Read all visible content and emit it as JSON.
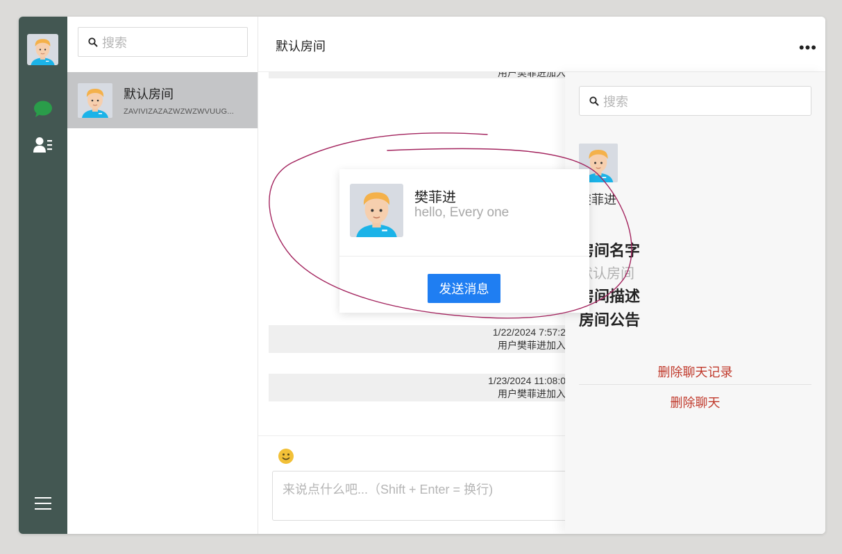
{
  "colors": {
    "rail": "#435752",
    "accent": "#1f7ef2",
    "danger": "#c0392b",
    "chat_icon": "#2a9d4a",
    "emoji": "#f2c037",
    "annotation": "#a3245e"
  },
  "list": {
    "search_placeholder": "搜索",
    "rooms": [
      {
        "name": "默认房间",
        "subtitle": "ZAVIVIZAZAZWZWZWVUUG..."
      }
    ]
  },
  "chat": {
    "title": "默认房间",
    "more_label": "•••",
    "messages": [
      {
        "time": "",
        "text": "用户樊菲进加入"
      },
      {
        "time": "1/22/2024 7:57:2",
        "text": "用户樊菲进加入"
      },
      {
        "time": "1/23/2024 11:08:0",
        "text": "用户樊菲进加入"
      }
    ],
    "input_placeholder": "来说点什么吧...（Shift + Enter = 换行)"
  },
  "drawer": {
    "search_placeholder": "搜索",
    "member_name": "樊菲进",
    "room_name_label": "房间名字",
    "room_name_value": "默认房间",
    "room_desc_label": "房间描述",
    "room_notice_label": "房间公告",
    "clear_history": "删除聊天记录",
    "delete_chat": "删除聊天"
  },
  "profile_card": {
    "name": "樊菲进",
    "message": "hello, Every one",
    "send_button": "发送消息"
  }
}
